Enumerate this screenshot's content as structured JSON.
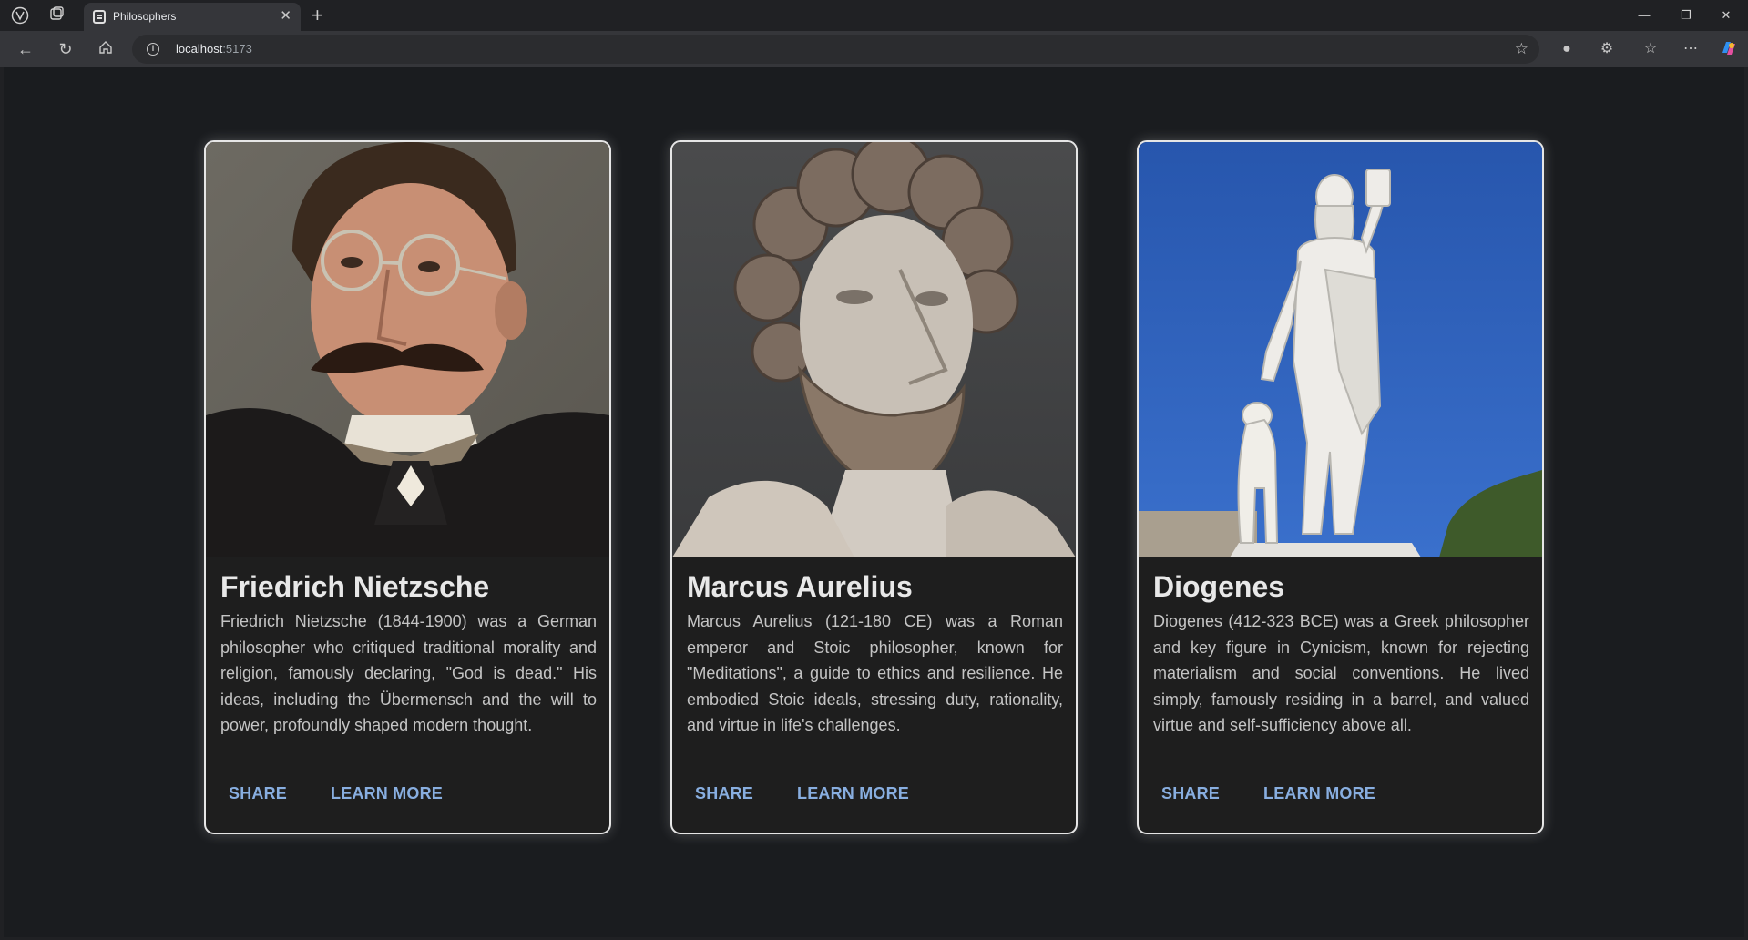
{
  "browser": {
    "tab_title": "Philosophers",
    "url_host": "localhost",
    "url_port": ":5173"
  },
  "cards": [
    {
      "name": "Friedrich Nietzsche",
      "description": "Friedrich Nietzsche (1844-1900) was a German philosopher who critiqued traditional morality and religion, famously declaring, \"God is dead.\" His ideas, including the Übermensch and the will to power, profoundly shaped modern thought.",
      "share_label": "SHARE",
      "learn_label": "LEARN MORE"
    },
    {
      "name": "Marcus Aurelius",
      "description": "Marcus Aurelius (121-180 CE) was a Roman emperor and Stoic philosopher, known for \"Meditations\", a guide to ethics and resilience. He embodied Stoic ideals, stressing duty, rationality, and virtue in life's challenges.",
      "share_label": "SHARE",
      "learn_label": "LEARN MORE"
    },
    {
      "name": "Diogenes",
      "description": "Diogenes (412-323 BCE) was a Greek philosopher and key figure in Cynicism, known for rejecting materialism and social conventions. He lived simply, famously residing in a barrel, and valued virtue and self-sufficiency above all.",
      "share_label": "SHARE",
      "learn_label": "LEARN MORE"
    }
  ],
  "colors": {
    "page_bg": "#1a1c1f",
    "card_bg": "#1e1e1e",
    "button_text": "#88aee0",
    "diogenes_sky": "#2f63c0"
  }
}
